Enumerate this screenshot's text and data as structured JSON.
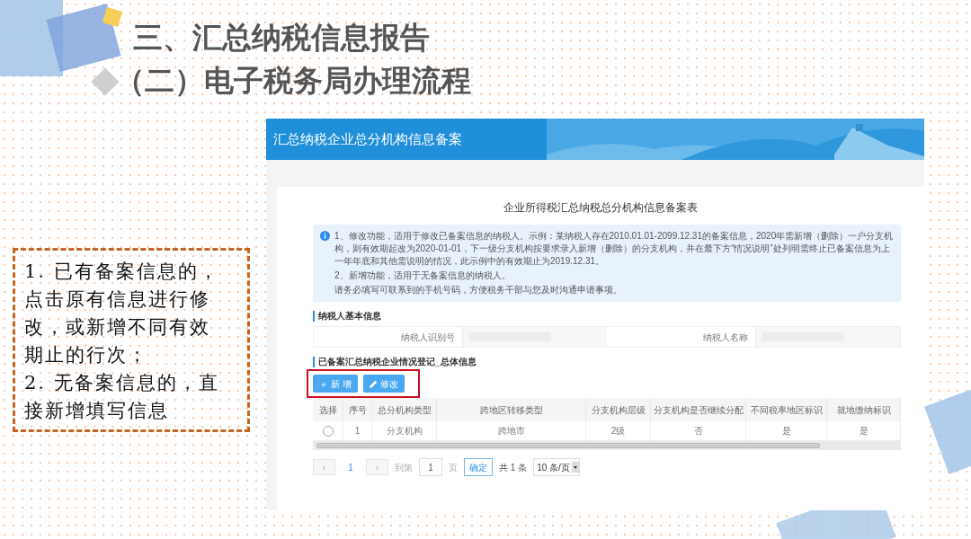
{
  "slide": {
    "title": "三、汇总纳税信息报告",
    "subtitle": "（二）电子税务局办理流程",
    "note_lines": [
      "1. 已有备案信息的，",
      "点击原有信息进行修",
      "改，或新增不同有效",
      "期止的行次；",
      "2. 无备案信息的，直",
      "接新增填写信息"
    ]
  },
  "app": {
    "header_title": "汇总纳税企业总分机构信息备案",
    "form_title": "企业所得税汇总纳税总分机构信息备案表",
    "notice": [
      "1、修改功能，适用于修改已备案信息的纳税人。示例：某纳税人存在2010.01.01-2099.12.31的备案信息，2020年需新增（删除）一户分支机构，则有效期起改为2020-01-01，下一级分支机构按要求录入新增（删除）的分支机构，并在最下方“情况说明”处列明需终止已备案信息为上一年年底和其他需说明的情况，此示例中的有效期止为2019.12.31。",
      "2、新增功能，适用于无备案信息的纳税人。",
      "请务必填写可联系到的手机号码，方便税务干部与您及时沟通申请事项。"
    ],
    "basic_section": "纳税人基本信息",
    "basic_fields": [
      "纳税人识别号",
      "纳税人名称"
    ],
    "record_section": "已备案汇总纳税企业情况登记_总体信息",
    "buttons": [
      {
        "kind": "add",
        "label": "新 增",
        "icon": "＋"
      },
      {
        "kind": "edit",
        "label": "修改"
      }
    ],
    "highlighted_buttons": true,
    "table": {
      "columns": [
        "选择",
        "序号",
        "总分机构类型",
        "跨地区转移类型",
        "分支机构层级",
        "分支机构是否继续分配",
        "不同税率地区标识",
        "就地缴纳标识"
      ],
      "rows": [
        {
          "selected": false,
          "cells": [
            "",
            "1",
            "分支机构",
            "跨地市",
            "2级",
            "否",
            "是",
            "是"
          ]
        }
      ]
    },
    "pagination": {
      "prev": "‹",
      "page": "1",
      "next": "›",
      "goto_label": "到第",
      "goto_value": "1",
      "page_unit": "页",
      "confirm": "确定",
      "total": "共 1 条",
      "page_size": "10 条/页"
    }
  }
}
